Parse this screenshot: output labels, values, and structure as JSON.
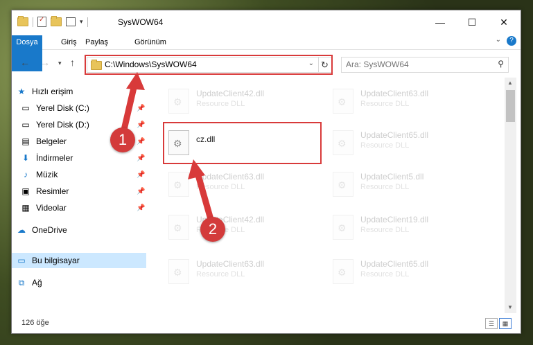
{
  "window": {
    "title": "SysWOW64",
    "minimize": "—",
    "maximize": "☐",
    "close": "✕"
  },
  "ribbon": {
    "tabs": [
      "Dosya",
      "Giriş",
      "Paylaş",
      "Görünüm"
    ],
    "help": "?"
  },
  "nav": {
    "address": "C:\\Windows\\SysWOW64",
    "search_placeholder": "Ara: SysWOW64"
  },
  "sidebar": {
    "items": [
      {
        "label": "Hızlı erişim",
        "icon": "star-icon"
      },
      {
        "label": "Yerel Disk (C:)",
        "icon": "drive-icon"
      },
      {
        "label": "Yerel Disk (D:)",
        "icon": "drive-icon"
      },
      {
        "label": "Belgeler",
        "icon": "documents-icon"
      },
      {
        "label": "İndirmeler",
        "icon": "download-icon"
      },
      {
        "label": "Müzik",
        "icon": "music-icon"
      },
      {
        "label": "Resimler",
        "icon": "pictures-icon"
      },
      {
        "label": "Videolar",
        "icon": "videos-icon"
      },
      {
        "label": "OneDrive",
        "icon": "cloud-icon"
      },
      {
        "label": "Bu bilgisayar",
        "icon": "computer-icon"
      },
      {
        "label": "Ağ",
        "icon": "network-icon"
      }
    ]
  },
  "files": [
    {
      "name": "UpdateClient42.dll",
      "type": "Resource DLL"
    },
    {
      "name": "UpdateClient63.dll",
      "type": "Resource DLL"
    },
    {
      "name": "cz.dll",
      "type": ""
    },
    {
      "name": "UpdateClient65.dll",
      "type": "Resource DLL"
    },
    {
      "name": "UpdateClient63.dll",
      "type": "Resource DLL"
    },
    {
      "name": "UpdateClient5.dll",
      "type": "Resource DLL"
    },
    {
      "name": "UpdateClient42.dll",
      "type": "Resource DLL"
    },
    {
      "name": "UpdateClient19.dll",
      "type": "Resource DLL"
    },
    {
      "name": "UpdateClient63.dll",
      "type": "Resource DLL"
    },
    {
      "name": "UpdateClient65.dll",
      "type": "Resource DLL"
    }
  ],
  "status": {
    "count": "126 öğe"
  },
  "callouts": [
    "1",
    "2"
  ],
  "colors": {
    "accent": "#1979ca",
    "highlight_red": "#d83a3a",
    "selected": "#cce8ff"
  }
}
